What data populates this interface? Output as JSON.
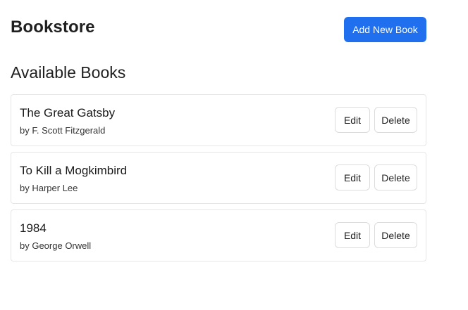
{
  "header": {
    "title": "Bookstore",
    "add_button_label": "Add New Book"
  },
  "section": {
    "title": "Available Books"
  },
  "actions": {
    "edit_label": "Edit",
    "delete_label": "Delete"
  },
  "books": [
    {
      "title": "The Great Gatsby",
      "author": "by F. Scott Fitzgerald"
    },
    {
      "title": "To Kill a Mogkimbird",
      "author": "by Harper Lee"
    },
    {
      "title": "1984",
      "author": "by George Orwell"
    }
  ],
  "colors": {
    "accent": "#1f6fee",
    "card_border": "#e6e6e6"
  }
}
